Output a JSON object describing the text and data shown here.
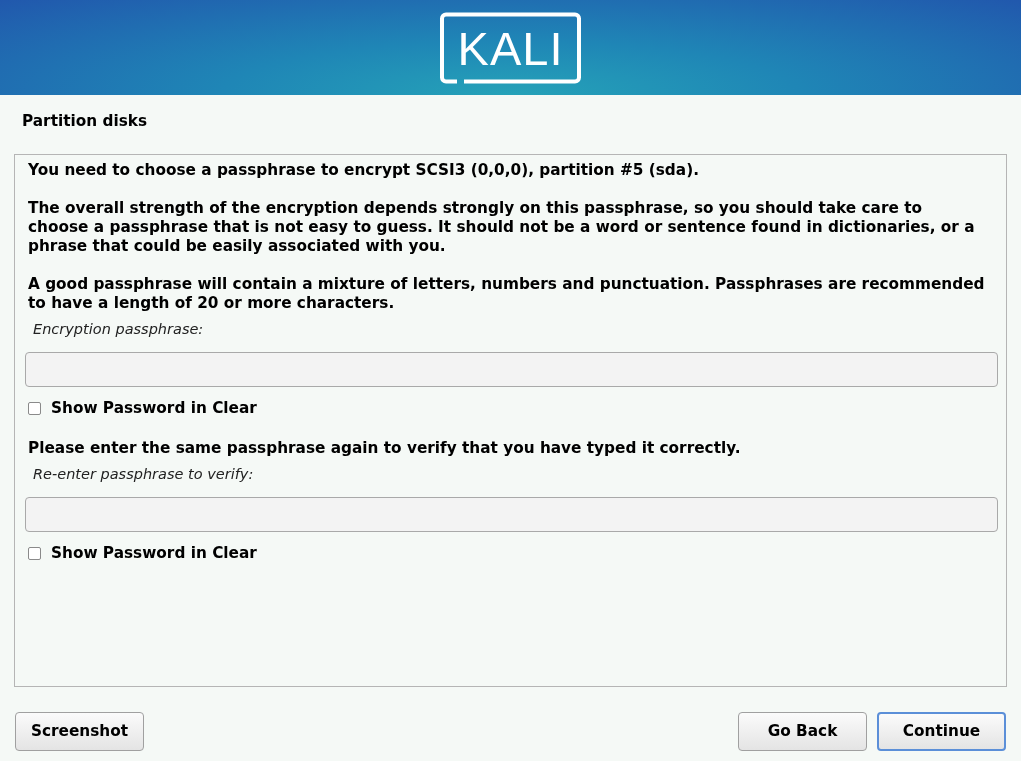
{
  "header": {
    "logo": "KALI"
  },
  "title": "Partition disks",
  "content": [
    {
      "kind": "paragraph",
      "text": "You need to choose a passphrase to encrypt SCSI3 (0,0,0), partition #5 (sda)."
    },
    {
      "kind": "paragraph",
      "text": "The overall strength of the encryption depends strongly on this passphrase, so you should take care to choose a passphrase that is not easy to guess. It should not be a word or sentence found in dictionaries, or a phrase that could be easily associated with you."
    },
    {
      "kind": "paragraph",
      "text": "A good passphrase will contain a mixture of letters, numbers and punctuation. Passphrases are recommended to have a length of 20 or more characters."
    },
    {
      "kind": "field",
      "label": "Encryption passphrase:"
    },
    {
      "kind": "checkbox",
      "label": "Show Password in Clear",
      "checked": false
    },
    {
      "kind": "paragraph",
      "text": "Please enter the same passphrase again to verify that you have typed it correctly."
    },
    {
      "kind": "field",
      "label": "Re-enter passphrase to verify:"
    },
    {
      "kind": "checkbox",
      "label": "Show Password in Clear",
      "checked": false
    }
  ],
  "buttons": {
    "left": [
      {
        "label": "Screenshot",
        "focused": false
      }
    ],
    "right": [
      {
        "label": "Go Back",
        "focused": false
      },
      {
        "label": "Continue",
        "focused": true
      }
    ]
  }
}
